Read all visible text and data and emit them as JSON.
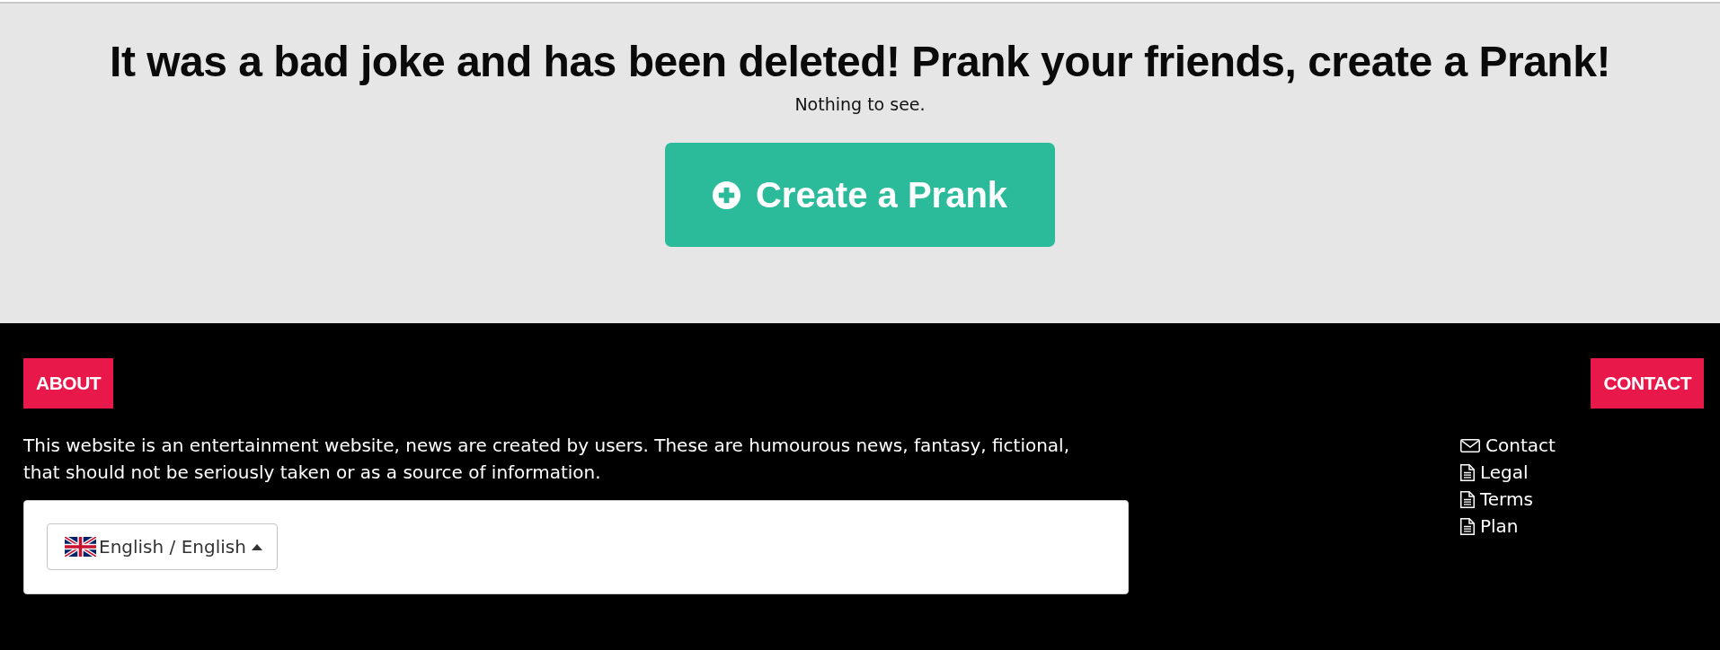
{
  "hero": {
    "title": "It was a bad joke and has been deleted! Prank your friends, create a Prank!",
    "subtitle": "Nothing to see.",
    "button": {
      "label": "Create a Prank"
    }
  },
  "footer": {
    "about": {
      "heading": "ABOUT",
      "text": "This website is an entertainment website, news are created by users. These are humourous news, fantasy, fictional, that should not be seriously taken or as a source of information.",
      "language": {
        "label": "English / English"
      }
    },
    "contact": {
      "heading": "CONTACT",
      "links": [
        {
          "label": "Contact",
          "kind": "mail"
        },
        {
          "label": "Legal",
          "kind": "document"
        },
        {
          "label": "Terms",
          "kind": "document"
        },
        {
          "label": "Plan",
          "kind": "document"
        }
      ]
    }
  }
}
